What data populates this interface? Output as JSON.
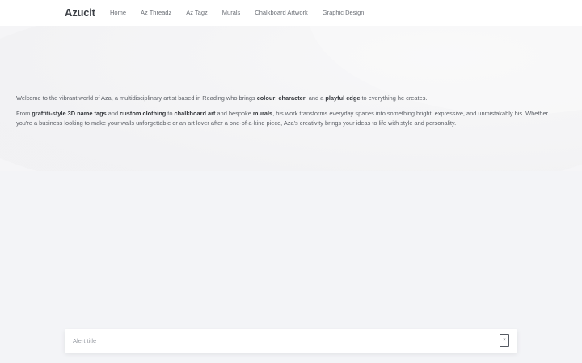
{
  "brand": "Azucit",
  "nav": {
    "items": [
      {
        "label": "Home"
      },
      {
        "label": "Az Threadz"
      },
      {
        "label": "Az Tagz"
      },
      {
        "label": "Murals"
      },
      {
        "label": "Chalkboard Artwork"
      },
      {
        "label": "Graphic Design"
      }
    ]
  },
  "intro": {
    "p1_a": "Welcome to the vibrant world of Aza, a multidisciplinary artist based in Reading who brings ",
    "p1_b": "colour",
    "p1_c": ", ",
    "p1_d": "character",
    "p1_e": ", and a ",
    "p1_f": "playful edge",
    "p1_g": " to everything he creates.",
    "p2_a": "From ",
    "p2_b": "graffiti-style 3D name tags",
    "p2_c": " and ",
    "p2_d": "custom clothing",
    "p2_e": " to ",
    "p2_f": "chalkboard art",
    "p2_g": " and bespoke ",
    "p2_h": "murals",
    "p2_i": ", his work transforms everyday spaces into something bright, expressive, and unmistakably his. Whether you're a business looking to make your walls unforgettable or an art lover after a one-of-a-kind piece, Aza's creativity brings your ideas to life with style and personality."
  },
  "alert": {
    "title": "Alert title",
    "close_glyph": "×"
  },
  "colors": {
    "accent": "#e23b3b",
    "background": "#f3f4f7"
  }
}
